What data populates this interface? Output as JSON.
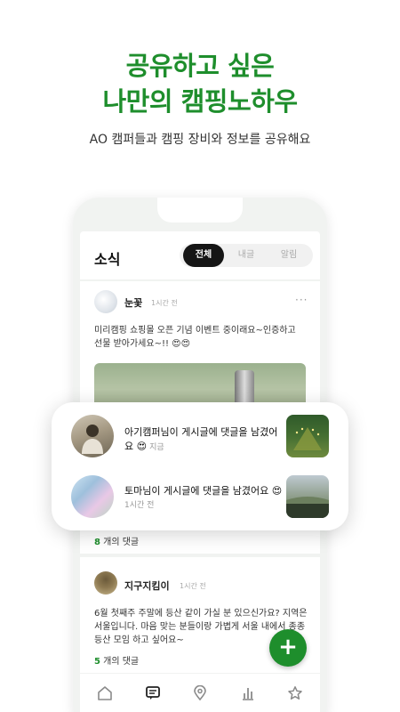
{
  "promo": {
    "headline_line1": "공유하고 싶은",
    "headline_line2": "나만의 캠핑노하우",
    "subtitle": "AO 캠퍼들과 캠핑 장비와 정보를 공유해요"
  },
  "feed": {
    "title": "소식",
    "tabs": [
      {
        "label": "전체",
        "active": true
      },
      {
        "label": "내글",
        "active": false
      },
      {
        "label": "알림",
        "active": false
      }
    ],
    "posts": [
      {
        "author": "눈꽃",
        "time": "1시간 전",
        "text": "미리캠핑 쇼핑몰 오픈 기념 이벤트 중이래요~인증하고 선물 받아가세요~!! 😍😍",
        "comment_count": "8",
        "comment_suffix": "개의 댓글"
      },
      {
        "author": "지구지킴이",
        "time": "1시간 전",
        "text": "6월 첫째주 주말에 등산 같이 가실 분 있으신가요? 지역은 서울입니다. 마음 맞는 분들이랑 가볍게 서울 내에서 종종 등산 모임 하고 싶어요~",
        "comment_count": "5",
        "comment_suffix": "개의 댓글"
      }
    ],
    "fab_label": "+"
  },
  "tabbar": {
    "icons": [
      "home-icon",
      "chat-icon",
      "location-pin-icon",
      "bar-chart-icon",
      "star-icon"
    ]
  },
  "notifications": [
    {
      "message": "아기캠퍼님이 게시글에 댓글을 남겼어요 😍",
      "time": "지금"
    },
    {
      "message": "토마님이 게시글에 댓글을 남겼어요 😍",
      "time": "1시간 전"
    }
  ],
  "colors": {
    "brand_green": "#1e8e2c",
    "tab_active": "#151515"
  }
}
